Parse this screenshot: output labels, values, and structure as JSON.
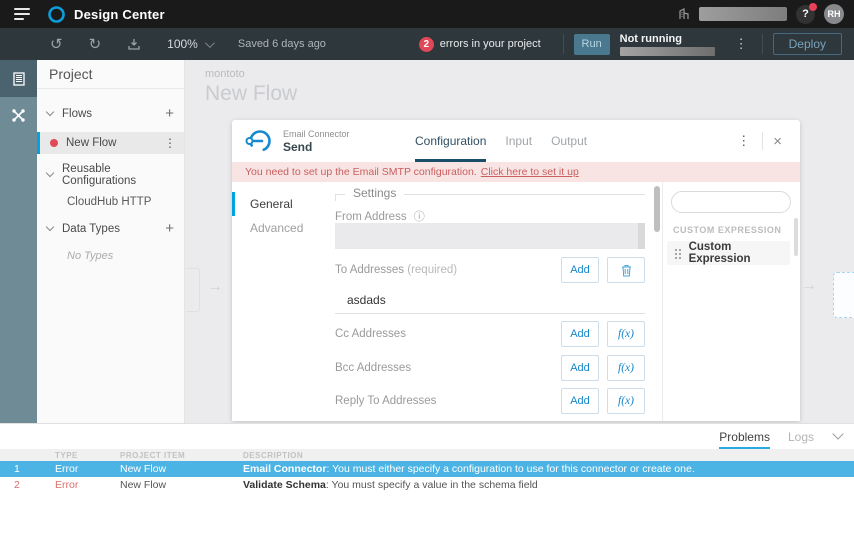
{
  "topbar": {
    "title": "Design Center",
    "help": "?",
    "avatar": "RH"
  },
  "toolbar": {
    "zoom": "100%",
    "saved": "Saved 6 days ago",
    "error_count": "2",
    "error_label": "errors in your project",
    "run": "Run",
    "status": "Not running",
    "deploy": "Deploy"
  },
  "project": {
    "title": "Project",
    "flows": "Flows",
    "new_flow": "New Flow",
    "reusable": "Reusable Configurations",
    "cloudhub": "CloudHub HTTP",
    "data_types": "Data Types",
    "no_types": "No Types"
  },
  "canvas": {
    "breadcrumb": "montoto",
    "title": "New Flow"
  },
  "dialog": {
    "connector": "Email Connector",
    "operation": "Send",
    "tabs": {
      "configuration": "Configuration",
      "input": "Input",
      "output": "Output"
    },
    "banner": {
      "text": "You need to set up the Email SMTP configuration.",
      "link": "Click here to set it up"
    },
    "nav": {
      "general": "General",
      "advanced": "Advanced"
    },
    "settings_legend": "Settings",
    "from": {
      "label": "From Address"
    },
    "to": {
      "label": "To Addresses",
      "required": "(required)",
      "value": "asdads"
    },
    "cc": {
      "label": "Cc Addresses"
    },
    "bcc": {
      "label": "Bcc Addresses"
    },
    "reply": {
      "label": "Reply To Addresses"
    },
    "buttons": {
      "add": "Add",
      "fx": "f(x)"
    },
    "palette": {
      "header": "CUSTOM EXPRESSION",
      "item": "Custom Expression"
    }
  },
  "problems": {
    "tabs": {
      "problems": "Problems",
      "logs": "Logs"
    },
    "columns": {
      "type": "TYPE",
      "item": "PROJECT ITEM",
      "description": "DESCRIPTION"
    },
    "rows": [
      {
        "num": "1",
        "type": "Error",
        "item": "New Flow",
        "source": "Email Connector",
        "text": ": You must either specify a configuration to use for this connector or create one."
      },
      {
        "num": "2",
        "type": "Error",
        "item": "New Flow",
        "source": "Validate Schema",
        "text": ": You must specify a value in the schema field"
      }
    ]
  },
  "colors": {
    "accent": "#00a3e0",
    "selected_row": "#4cb4e4",
    "error_red": "#d9534f",
    "banner_bg": "#f9e4e4",
    "banner_text": "#c96060"
  }
}
